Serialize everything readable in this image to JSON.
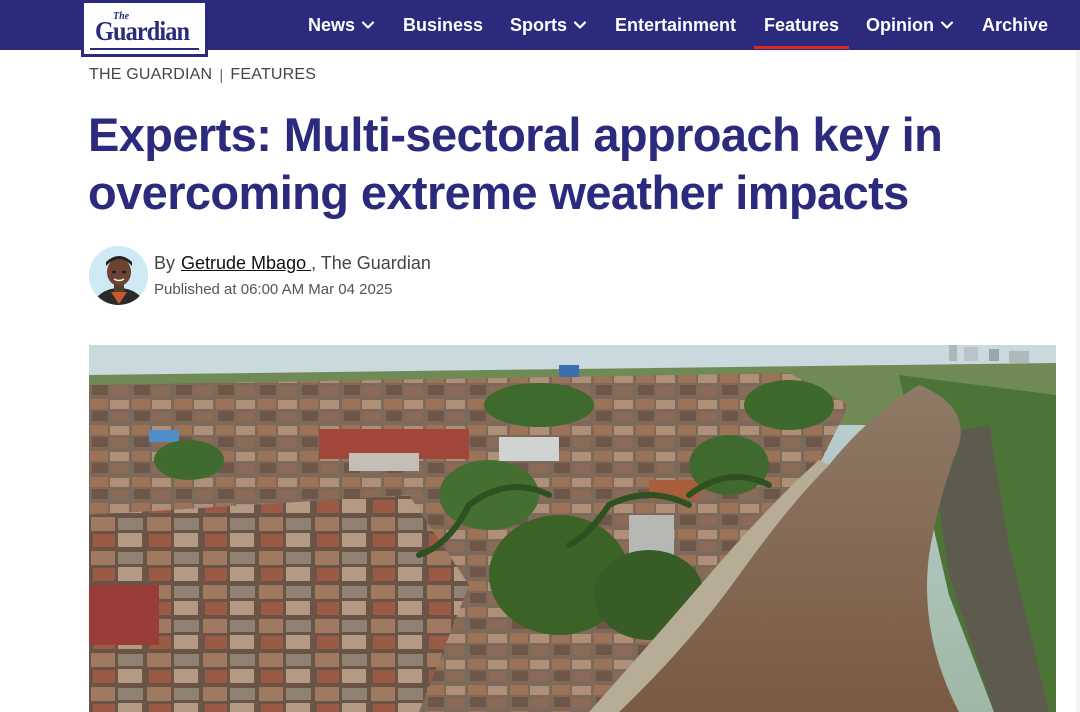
{
  "brand": {
    "small": "The",
    "main": "Guardian"
  },
  "nav": {
    "items": [
      {
        "label": "News",
        "has_dropdown": true
      },
      {
        "label": "Business",
        "has_dropdown": false
      },
      {
        "label": "Sports",
        "has_dropdown": true
      },
      {
        "label": "Entertainment",
        "has_dropdown": false
      },
      {
        "label": "Features",
        "has_dropdown": false,
        "active": true
      },
      {
        "label": "Opinion",
        "has_dropdown": true
      },
      {
        "label": "Archive",
        "has_dropdown": false
      }
    ]
  },
  "breadcrumb": {
    "home": "THE GUARDIAN",
    "separator": "|",
    "section": "FEATURES"
  },
  "article": {
    "headline_line1": "Experts: Multi-sectoral approach key in",
    "headline_line2": "overcoming extreme weather impacts",
    "by_prefix": "By",
    "author": "Getrude Mbago ",
    "publication_suffix": ", The Guardian",
    "published": "Published at 06:00 AM Mar 04 2025"
  },
  "colors": {
    "brand_navy": "#2b2a7d",
    "active_underline": "#e3261f",
    "text_gray": "#444444"
  },
  "icons": {
    "dropdown": "chevron-down-icon",
    "avatar": "author-avatar",
    "hero": "aerial-river-settlement-photo"
  }
}
